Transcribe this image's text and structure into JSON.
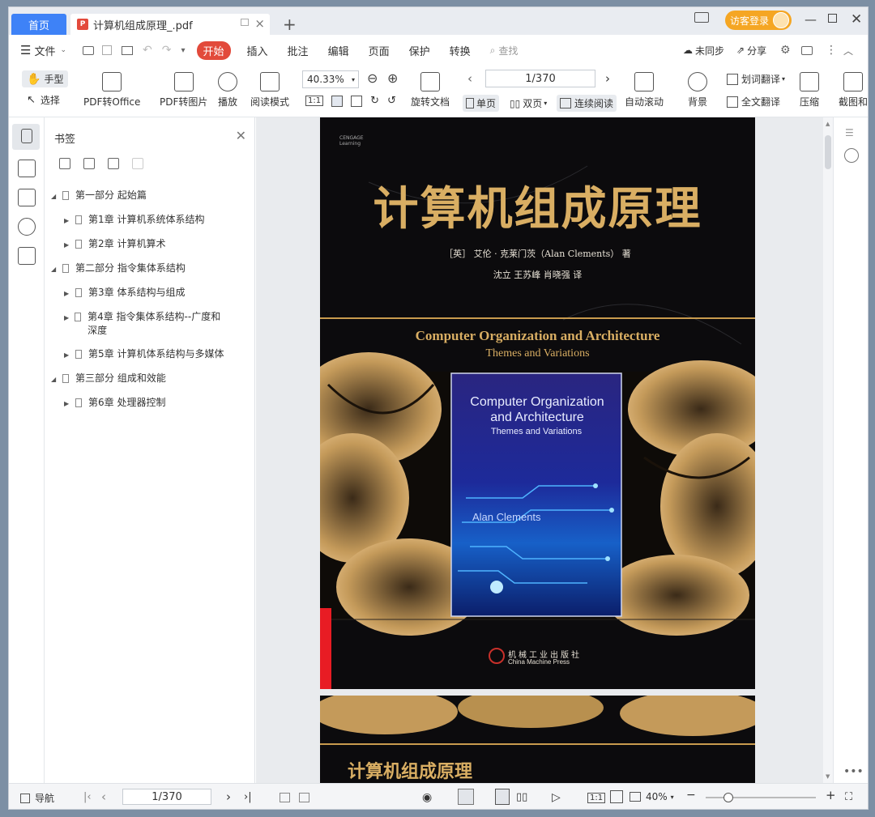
{
  "titlebar": {
    "home_tab": "首页",
    "doc_tab": "计算机组成原理_.pdf",
    "pdf_icon_letter": "P",
    "new_tab": "+",
    "login": "访客登录",
    "close_tab": "×"
  },
  "menu": {
    "file": "文件",
    "items": [
      "开始",
      "插入",
      "批注",
      "编辑",
      "页面",
      "保护",
      "转换"
    ],
    "search": "查找",
    "unsync": "未同步",
    "share": "分享"
  },
  "ribbon": {
    "hand": "手型",
    "select": "选择",
    "pdf_to_office": "PDF转Office",
    "pdf_to_image": "PDF转图片",
    "play": "播放",
    "read_mode": "阅读模式",
    "zoom": "40.33%",
    "page": "1/370",
    "rotate": "旋转文档",
    "single": "单页",
    "double": "双页",
    "continuous": "连续阅读",
    "auto_scroll": "自动滚动",
    "background": "背景",
    "word_translate": "划词翻译",
    "full_translate": "全文翻译",
    "compress": "压缩",
    "screenshot": "截图和"
  },
  "panel": {
    "title": "书签",
    "tree": [
      {
        "label": "第一部分  起始篇",
        "level": 0
      },
      {
        "label": "第1章  计算机系统体系结构",
        "level": 1
      },
      {
        "label": "第2章  计算机算术",
        "level": 1
      },
      {
        "label": "第二部分  指令集体系结构",
        "level": 0
      },
      {
        "label": "第3章  体系结构与组成",
        "level": 1
      },
      {
        "label": "第4章  指令集体系结构--广度和深度",
        "level": 1
      },
      {
        "label": "第5章  计算机体系结构与多媒体",
        "level": 1
      },
      {
        "label": "第三部分  组成和效能",
        "level": 0
      },
      {
        "label": "第6章  处理器控制",
        "level": 1
      }
    ]
  },
  "cover": {
    "publisher_small": "CENGAGE Learning",
    "title_cn": "计算机组成原理",
    "author_line": "［英］ 艾伦 · 克莱门茨（Alan Clements） 著",
    "translators": "沈立 王苏峰 肖晓强  译",
    "title_en": "Computer Organization and Architecture",
    "subtitle_en": "Themes and Variations",
    "inner_title": "Computer Organization and Architecture",
    "inner_subtitle": "Themes and Variations",
    "inner_author": "Alan Clements",
    "press_cn": "机械工业出版社",
    "press_en": "China Machine Press",
    "page2_title": "计算机组成原理"
  },
  "status": {
    "nav": "导航",
    "page": "1/370",
    "zoom": "40%",
    "one_to_one": "1:1"
  },
  "colors": {
    "accent": "#3e82f7",
    "start_tab": "#e24a3b",
    "gold": "#d9ae63",
    "login": "#f5a623"
  }
}
